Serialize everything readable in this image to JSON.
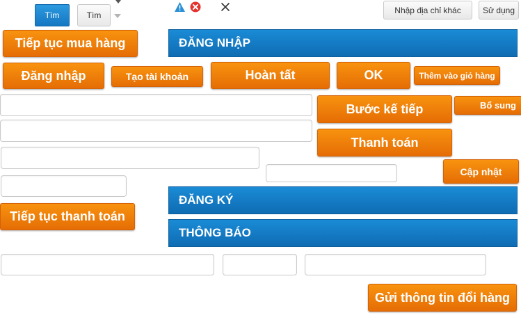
{
  "toolbar": {
    "search_primary_label": "Tìm",
    "search_secondary_label": "Tìm",
    "address_button_label": "Nhập địa chỉ khác",
    "use_button_label": "Sử dụng"
  },
  "icons": {
    "warning": "warning-icon",
    "error": "error-icon",
    "close": "close-icon",
    "dropdown": "chevron-down-icon"
  },
  "buttons": {
    "continue_shopping": "Tiếp tục mua hàng",
    "login": "Đăng nhập",
    "create_account": "Tạo tài khoản",
    "complete": "Hoàn tất",
    "ok": "OK",
    "add_to_cart": "Thêm vào giỏ hàng",
    "next_step": "Bước kế tiếp",
    "supplement": "Bổ sung",
    "payment": "Thanh toán",
    "update": "Cập nhật",
    "continue_payment": "Tiếp tục thanh toán",
    "send_exchange_info": "Gửi thông tin đổi hàng"
  },
  "sections": {
    "login": "ĐĂNG NHẬP",
    "register": "ĐĂNG KÝ",
    "notice": "THÔNG BÁO"
  },
  "inputs": {
    "field_1": {
      "value": "",
      "placeholder": ""
    },
    "field_2": {
      "value": "",
      "placeholder": ""
    },
    "field_3": {
      "value": "",
      "placeholder": ""
    },
    "field_4": {
      "value": "",
      "placeholder": ""
    },
    "field_5": {
      "value": "",
      "placeholder": ""
    },
    "field_6": {
      "value": "",
      "placeholder": ""
    },
    "field_7": {
      "value": "",
      "placeholder": ""
    },
    "field_8": {
      "value": "",
      "placeholder": ""
    }
  },
  "colors": {
    "orange_button": "#f08010",
    "blue_bar": "#1577c2",
    "primary_blue": "#1a8bd6"
  }
}
